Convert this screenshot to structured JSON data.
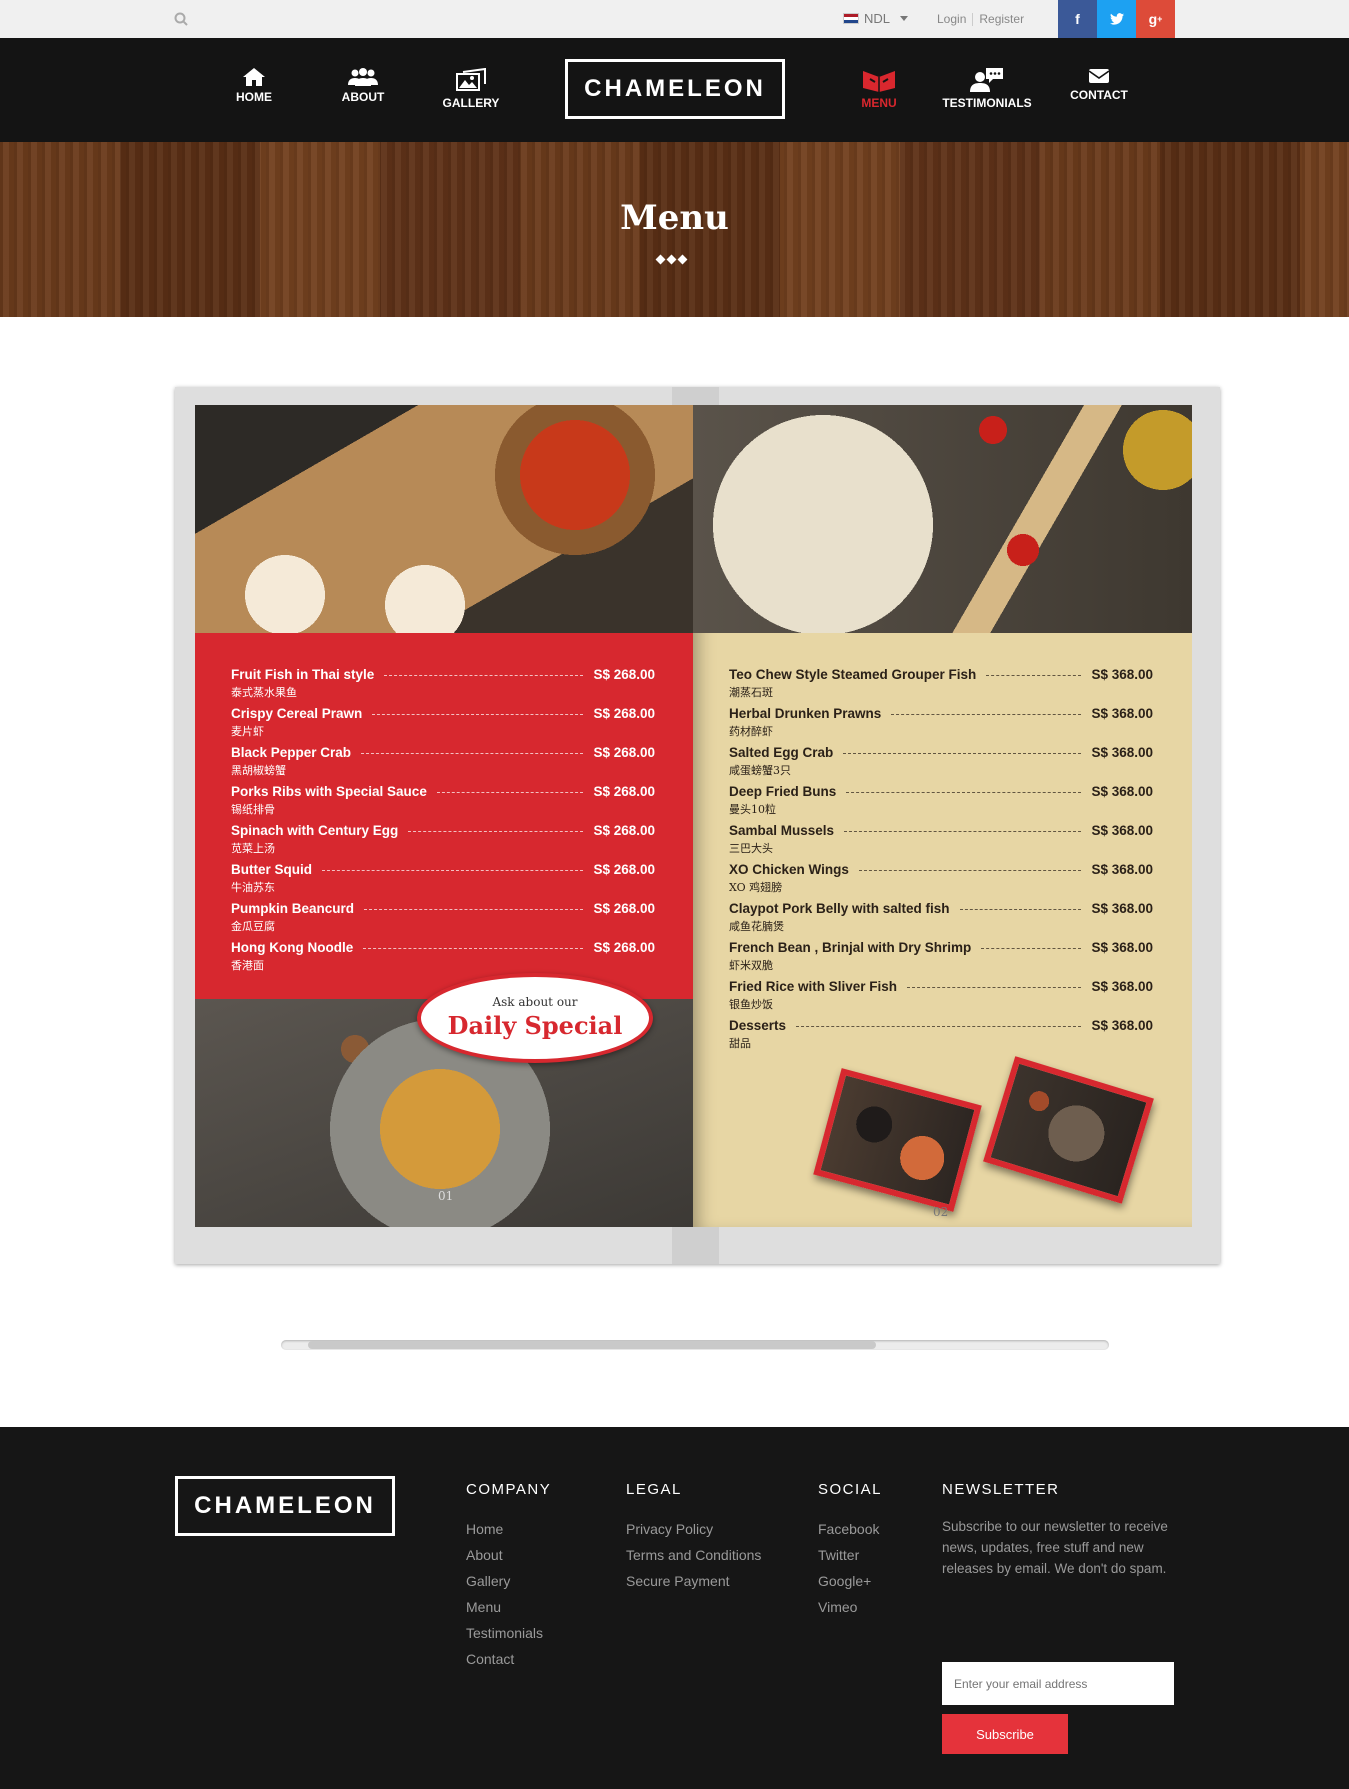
{
  "topbar": {
    "language": "NDL",
    "login": "Login",
    "register": "Register",
    "social": [
      {
        "icon": "facebook-icon",
        "glyph": "f",
        "color": "#3b5998"
      },
      {
        "icon": "twitter-icon",
        "glyph": "t",
        "color": "#1da1f2"
      },
      {
        "icon": "google-plus-icon",
        "glyph": "g+",
        "color": "#dd4b39"
      }
    ]
  },
  "nav": {
    "logo": "CHAMELEON",
    "items": [
      {
        "label": "HOME",
        "icon": "home-icon"
      },
      {
        "label": "ABOUT",
        "icon": "people-icon"
      },
      {
        "label": "GALLERY",
        "icon": "gallery-icon"
      },
      {
        "label": "MENU",
        "icon": "menu-mask-icon",
        "active": true
      },
      {
        "label": "TESTIMONIALS",
        "icon": "chat-user-icon"
      },
      {
        "label": "CONTACT",
        "icon": "envelope-icon"
      }
    ],
    "active_color": "#d9272e"
  },
  "hero": {
    "title": "Menu"
  },
  "book": {
    "left_items": [
      {
        "name": "Fruit Fish in Thai style",
        "chinese": "泰式蒸水果鱼",
        "price": "S$ 268.00"
      },
      {
        "name": "Crispy Cereal Prawn",
        "chinese": "麦片虾",
        "price": "S$ 268.00"
      },
      {
        "name": "Black Pepper Crab",
        "chinese": "黑胡椒螃蟹",
        "price": "S$ 268.00"
      },
      {
        "name": "Porks Ribs with Special Sauce",
        "chinese": "锡纸排骨",
        "price": "S$ 268.00"
      },
      {
        "name": "Spinach with Century Egg",
        "chinese": "苋菜上汤",
        "price": "S$ 268.00"
      },
      {
        "name": "Butter Squid",
        "chinese": "牛油苏东",
        "price": "S$ 268.00"
      },
      {
        "name": "Pumpkin Beancurd",
        "chinese": "金瓜豆腐",
        "price": "S$ 268.00"
      },
      {
        "name": "Hong Kong Noodle",
        "chinese": "香港面",
        "price": "S$ 268.00"
      }
    ],
    "right_items": [
      {
        "name": "Teo Chew Style Steamed Grouper Fish",
        "chinese": "潮蒸石斑",
        "price": "S$ 368.00"
      },
      {
        "name": "Herbal Drunken Prawns",
        "chinese": "药材醉虾",
        "price": "S$ 368.00"
      },
      {
        "name": "Salted Egg Crab",
        "chinese": "咸蛋螃蟹3只",
        "price": "S$ 368.00"
      },
      {
        "name": "Deep Fried Buns",
        "chinese": "曼头10粒",
        "price": "S$ 368.00"
      },
      {
        "name": "Sambal Mussels",
        "chinese": "三巴大头",
        "price": "S$ 368.00"
      },
      {
        "name": "XO Chicken Wings",
        "chinese": "XO 鸡翅膀",
        "price": "S$ 368.00"
      },
      {
        "name": "Claypot Pork Belly with salted fish",
        "chinese": "咸鱼花腩煲",
        "price": "S$ 368.00"
      },
      {
        "name": "French Bean , Brinjal with Dry Shrimp",
        "chinese": "虾米双脆",
        "price": "S$ 368.00"
      },
      {
        "name": "Fried Rice with Sliver Fish",
        "chinese": "银鱼炒饭",
        "price": "S$ 368.00"
      },
      {
        "name": "Desserts",
        "chinese": "甜品",
        "price": "S$ 368.00"
      }
    ],
    "special_ask": "Ask about our",
    "special_title": "Daily Special",
    "page_left": "01",
    "page_right": "02",
    "left_color": "#d7282f",
    "right_color": "#e7d6a4"
  },
  "footer": {
    "logo": "CHAMELEON",
    "company": {
      "title": "COMPANY",
      "links": [
        "Home",
        "About",
        "Gallery",
        "Menu",
        "Testimonials",
        "Contact"
      ]
    },
    "legal": {
      "title": "LEGAL",
      "links": [
        "Privacy Policy",
        "Terms and Conditions",
        "Secure Payment"
      ]
    },
    "social": {
      "title": "SOCIAL",
      "links": [
        "Facebook",
        "Twitter",
        "Google+",
        "Vimeo"
      ]
    },
    "newsletter": {
      "title": "NEWSLETTER",
      "text": "Subscribe to our newsletter to receive news, updates, free stuff and new releases by email. We don't do spam.",
      "placeholder": "Enter your email address",
      "button": "Subscribe",
      "button_color": "#e5333b"
    }
  }
}
